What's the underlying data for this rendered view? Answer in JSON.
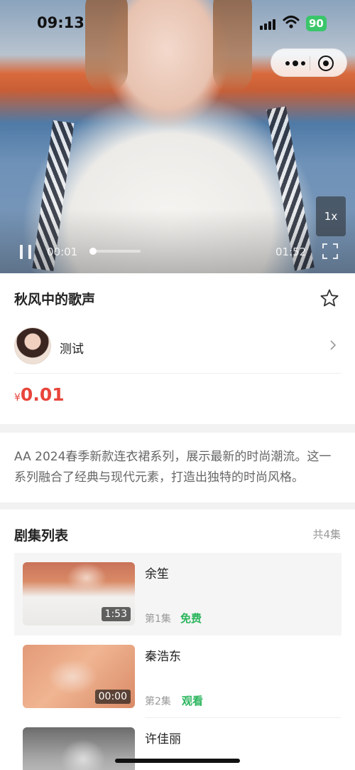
{
  "status_bar": {
    "time": "09:13",
    "battery": "90",
    "signal_icon": "signal-bars-icon",
    "wifi_icon": "wifi-icon"
  },
  "capsule": {
    "more_icon": "more-dots-icon",
    "close_icon": "close-miniprogram-icon"
  },
  "player": {
    "current_time": "00:01",
    "total_time": "01:52",
    "progress_fraction": 0.01,
    "speed": "1x"
  },
  "video": {
    "title": "秋风中的歌声",
    "author": "测试",
    "price_currency": "¥",
    "price_value": "0.01"
  },
  "description": "AA 2024春季新款连衣裙系列，展示最新的时尚潮流。这一系列融合了经典与现代元素，打造出独特的时尚风格。",
  "episode_list": {
    "title": "剧集列表",
    "count": "共4集",
    "items": [
      {
        "name": "余笙",
        "number": "第1集",
        "tag": "免费",
        "duration": "1:53"
      },
      {
        "name": "秦浩东",
        "number": "第2集",
        "tag": "观看",
        "duration": "00:00"
      },
      {
        "name": "许佳丽",
        "number": "",
        "tag": "",
        "duration": ""
      }
    ]
  },
  "colors": {
    "accent_red": "#e8453c",
    "accent_green": "#2bb55c"
  }
}
